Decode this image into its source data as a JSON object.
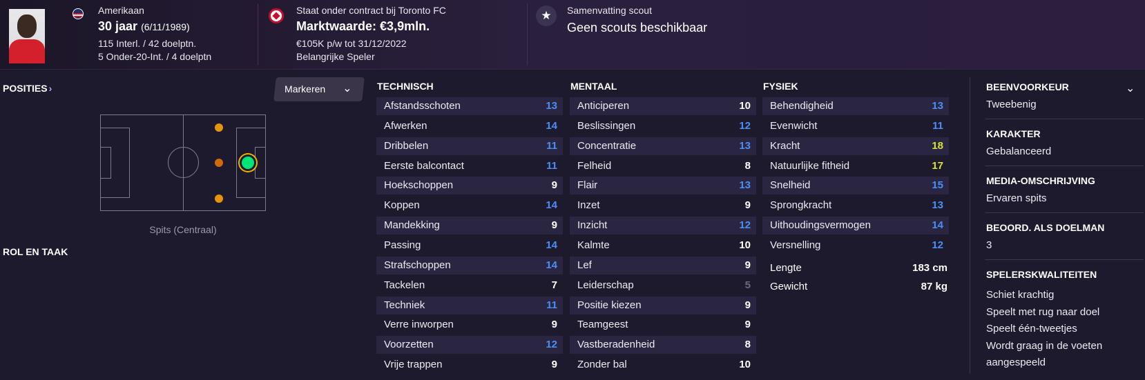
{
  "header": {
    "nationality": "Amerikaan",
    "age": "30 jaar",
    "birthdate": "(6/11/1989)",
    "caps_line1": "115 Interl. / 42 doelptn.",
    "caps_line2": "5 Onder-20-Int. / 4 doelptn",
    "contract_label": "Staat onder contract bij Toronto FC",
    "market_value": "Marktwaarde: €3,9mln.",
    "wage": "€105K p/w tot 31/12/2022",
    "status": "Belangrijke Speler",
    "scout_label": "Samenvatting scout",
    "scout_value": "Geen scouts beschikbaar"
  },
  "left": {
    "positions_title": "POSITIES",
    "markeren_label": "Markeren",
    "position_label": "Spits (Centraal)",
    "role_title": "ROL EN TAAK"
  },
  "attributes": {
    "technisch": {
      "title": "TECHNISCH",
      "items": [
        {
          "name": "Afstandsschoten",
          "value": "13",
          "color": "blue"
        },
        {
          "name": "Afwerken",
          "value": "14",
          "color": "blue"
        },
        {
          "name": "Dribbelen",
          "value": "11",
          "color": "blue"
        },
        {
          "name": "Eerste balcontact",
          "value": "11",
          "color": "blue"
        },
        {
          "name": "Hoekschoppen",
          "value": "9",
          "color": "white"
        },
        {
          "name": "Koppen",
          "value": "14",
          "color": "blue"
        },
        {
          "name": "Mandekking",
          "value": "9",
          "color": "white"
        },
        {
          "name": "Passing",
          "value": "14",
          "color": "blue"
        },
        {
          "name": "Strafschoppen",
          "value": "14",
          "color": "blue"
        },
        {
          "name": "Tackelen",
          "value": "7",
          "color": "white"
        },
        {
          "name": "Techniek",
          "value": "11",
          "color": "blue"
        },
        {
          "name": "Verre inworpen",
          "value": "9",
          "color": "white"
        },
        {
          "name": "Voorzetten",
          "value": "12",
          "color": "blue"
        },
        {
          "name": "Vrije trappen",
          "value": "9",
          "color": "white"
        }
      ]
    },
    "mentaal": {
      "title": "MENTAAL",
      "items": [
        {
          "name": "Anticiperen",
          "value": "10",
          "color": "white"
        },
        {
          "name": "Beslissingen",
          "value": "12",
          "color": "blue"
        },
        {
          "name": "Concentratie",
          "value": "13",
          "color": "blue"
        },
        {
          "name": "Felheid",
          "value": "8",
          "color": "white"
        },
        {
          "name": "Flair",
          "value": "13",
          "color": "blue"
        },
        {
          "name": "Inzet",
          "value": "9",
          "color": "white"
        },
        {
          "name": "Inzicht",
          "value": "12",
          "color": "blue"
        },
        {
          "name": "Kalmte",
          "value": "10",
          "color": "white"
        },
        {
          "name": "Lef",
          "value": "9",
          "color": "white"
        },
        {
          "name": "Leiderschap",
          "value": "5",
          "color": "grey"
        },
        {
          "name": "Positie kiezen",
          "value": "9",
          "color": "white"
        },
        {
          "name": "Teamgeest",
          "value": "9",
          "color": "white"
        },
        {
          "name": "Vastberadenheid",
          "value": "8",
          "color": "white"
        },
        {
          "name": "Zonder bal",
          "value": "10",
          "color": "white"
        }
      ]
    },
    "fysiek": {
      "title": "FYSIEK",
      "items": [
        {
          "name": "Behendigheid",
          "value": "13",
          "color": "blue"
        },
        {
          "name": "Evenwicht",
          "value": "11",
          "color": "blue"
        },
        {
          "name": "Kracht",
          "value": "18",
          "color": "yellow"
        },
        {
          "name": "Natuurlijke fitheid",
          "value": "17",
          "color": "yellow"
        },
        {
          "name": "Snelheid",
          "value": "15",
          "color": "blue"
        },
        {
          "name": "Sprongkracht",
          "value": "13",
          "color": "blue"
        },
        {
          "name": "Uithoudingsvermogen",
          "value": "14",
          "color": "blue"
        },
        {
          "name": "Versnelling",
          "value": "12",
          "color": "blue"
        }
      ],
      "height_label": "Lengte",
      "height_value": "183 cm",
      "weight_label": "Gewicht",
      "weight_value": "87 kg"
    }
  },
  "right": {
    "foot_title": "BEENVOORKEUR",
    "foot_value": "Tweebenig",
    "character_title": "KARAKTER",
    "character_value": "Gebalanceerd",
    "media_title": "MEDIA-OMSCHRIJVING",
    "media_value": "Ervaren spits",
    "gk_title": "BEOORD. ALS DOELMAN",
    "gk_value": "3",
    "traits_title": "SPELERSKWALITEITEN",
    "traits": [
      "Schiet krachtig",
      "Speelt met rug naar doel",
      "Speelt één-tweetjes",
      "Wordt graag in de voeten",
      "aangespeeld"
    ]
  },
  "colors": {
    "blue": "#4a8ff7",
    "white": "#ffffff",
    "grey": "#6d6880",
    "yellow": "#d9e22c",
    "background": "#1e1a2e",
    "row_stripe": "#2a2540"
  },
  "icons": {
    "nation": "us-flag-icon",
    "club": "toronto-fc-crest-icon",
    "scout": "star-icon"
  }
}
